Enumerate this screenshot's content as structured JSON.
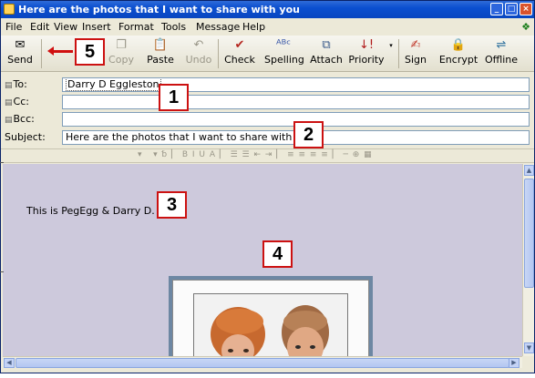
{
  "window": {
    "title": "Here are the photos that I want to share with you"
  },
  "menus": [
    "File",
    "Edit",
    "View",
    "Insert",
    "Format",
    "Tools",
    "Message",
    "Help"
  ],
  "toolbar": {
    "send": "Send",
    "copy": "Copy",
    "paste": "Paste",
    "undo": "Undo",
    "check": "Check",
    "spelling": "Spelling",
    "attach": "Attach",
    "priority": "Priority",
    "sign": "Sign",
    "encrypt": "Encrypt",
    "offline": "Offline"
  },
  "headers": {
    "to_label": "To:",
    "to_value": "Darry D Eggleston",
    "cc_label": "Cc:",
    "cc_value": "",
    "bcc_label": "Bcc:",
    "bcc_value": "",
    "subject_label": "Subject:",
    "subject_value": "Here are the photos that I want to share with you"
  },
  "message": {
    "text": "This is PegEgg & Darry D."
  },
  "callouts": {
    "c1": "1",
    "c2": "2",
    "c3": "3",
    "c4": "4",
    "c5": "5"
  },
  "colors": {
    "callout_border": "#cc1111",
    "body_background": "#cdc9dc",
    "titlebar": "#0b4fd0"
  }
}
